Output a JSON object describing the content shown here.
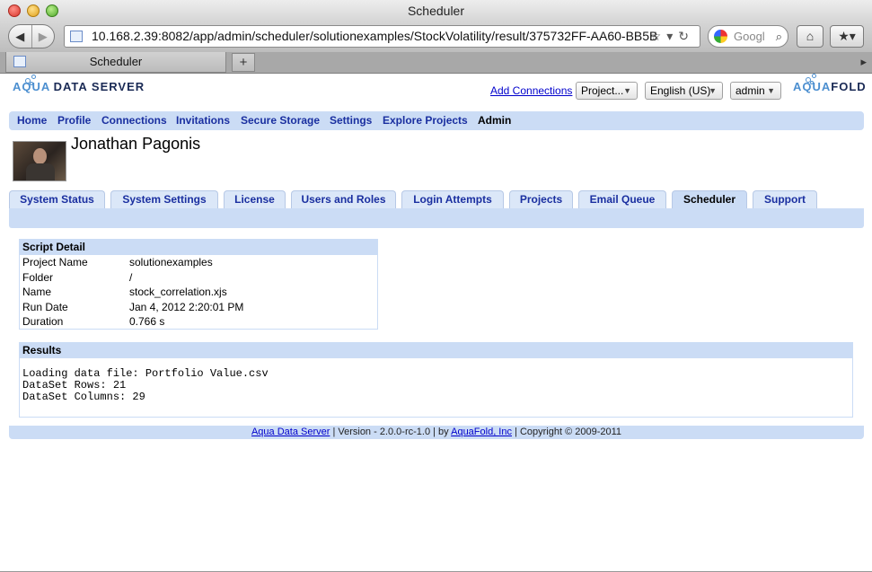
{
  "window": {
    "title": "Scheduler"
  },
  "browser": {
    "back_icon": "◀",
    "forward_icon": "▶",
    "url": "10.168.2.39:8082/app/admin/scheduler/solutionexamples/StockVolatility/result/375732FF-AA60-BB5B",
    "url_tools": "☆▾↻",
    "search_placeholder": "Googl",
    "search_icon": "⌕",
    "home_icon": "⌂",
    "bookmarks_icon": "★▾",
    "tab_title": "Scheduler",
    "new_tab_label": "+",
    "tab_scroll_label": "▸"
  },
  "app": {
    "logo_left_aqua": "AQUA",
    "logo_left_server": "DATA SERVER",
    "logo_right_aqua": "AQUA",
    "logo_right_fold": "FOLD",
    "add_connections": "Add Connections",
    "project_select": "Project...",
    "language_select": "English (US)",
    "user_select": "admin",
    "dropdown_arrow": "▼"
  },
  "nav": {
    "home": "Home",
    "profile": "Profile",
    "connections": "Connections",
    "invitations": "Invitations",
    "secure_storage": "Secure Storage",
    "settings": "Settings",
    "explore_projects": "Explore Projects",
    "admin": "Admin"
  },
  "user": {
    "name": "Jonathan Pagonis"
  },
  "admin_tabs": {
    "system_status": "System Status",
    "system_settings": "System Settings",
    "license": "License",
    "users_and_roles": "Users and Roles",
    "login_attempts": "Login Attempts",
    "projects": "Projects",
    "email_queue": "Email Queue",
    "scheduler": "Scheduler",
    "support": "Support"
  },
  "script_detail": {
    "title": "Script Detail",
    "rows": [
      {
        "label": "Project Name",
        "value": "solutionexamples"
      },
      {
        "label": "Folder",
        "value": "/"
      },
      {
        "label": "Name",
        "value": "stock_correlation.xjs"
      },
      {
        "label": "Run Date",
        "value": "Jan 4, 2012 2:20:01 PM"
      },
      {
        "label": "Duration",
        "value": "0.766 s"
      }
    ]
  },
  "results": {
    "title": "Results",
    "output": "Loading data file: Portfolio Value.csv\nDataSet Rows: 21\nDataSet Columns: 29"
  },
  "footer": {
    "product_link": "Aqua Data Server",
    "version_text": " | Version - 2.0.0-rc-1.0 | by ",
    "company_link": "AquaFold, Inc",
    "copyright_text": " | Copyright © 2009-2011"
  }
}
